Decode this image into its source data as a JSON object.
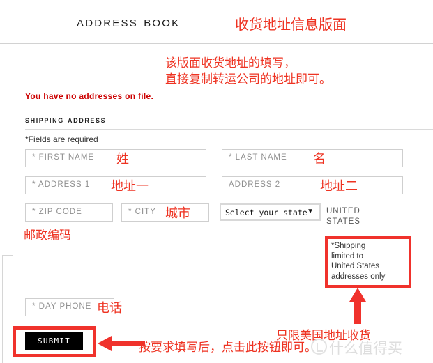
{
  "header": {
    "title": "Address Book",
    "title_note_cn": "收货地址信息版面"
  },
  "annotations": {
    "top_note_cn": "该版面收货地址的填写，\n直接复制转运公司的地址即可。",
    "zip_note_cn": "邮政编码",
    "us_limit_note_cn": "只限美国地址收货",
    "submit_note_cn": "按要求填写后，点击此按钮即可。"
  },
  "status": {
    "no_addresses": "You have no addresses on file."
  },
  "section": {
    "title": "Shipping Address",
    "required_note": "*Fields are required"
  },
  "fields": [
    {
      "name": "first-name",
      "placeholder": "* FIRST NAME",
      "cn": "姓"
    },
    {
      "name": "last-name",
      "placeholder": "* LAST NAME",
      "cn": "名"
    },
    {
      "name": "address-1",
      "placeholder": "* ADDRESS 1",
      "cn": "地址一"
    },
    {
      "name": "address-2",
      "placeholder": "ADDRESS 2",
      "cn": "地址二"
    },
    {
      "name": "zip-code",
      "placeholder": "* ZIP CODE",
      "cn": ""
    },
    {
      "name": "city",
      "placeholder": "* CITY",
      "cn": "城市"
    },
    {
      "name": "day-phone",
      "placeholder": "* DAY PHONE",
      "cn": "电话"
    }
  ],
  "state_select": {
    "selected": "Select your state",
    "caret": "▼"
  },
  "country": "UNITED\nSTATES",
  "warning_box": {
    "text": "*Shipping\nlimited to\nUnited States\naddresses only"
  },
  "submit": {
    "label": "SUBMIT"
  },
  "watermark": {
    "text": "什么值得买"
  },
  "colors": {
    "annotation_red": "#ee3322",
    "box_red": "#f0322c",
    "error_red": "#cc0000",
    "field_border": "#cfcfcf",
    "rule": "#d2d2d2"
  }
}
